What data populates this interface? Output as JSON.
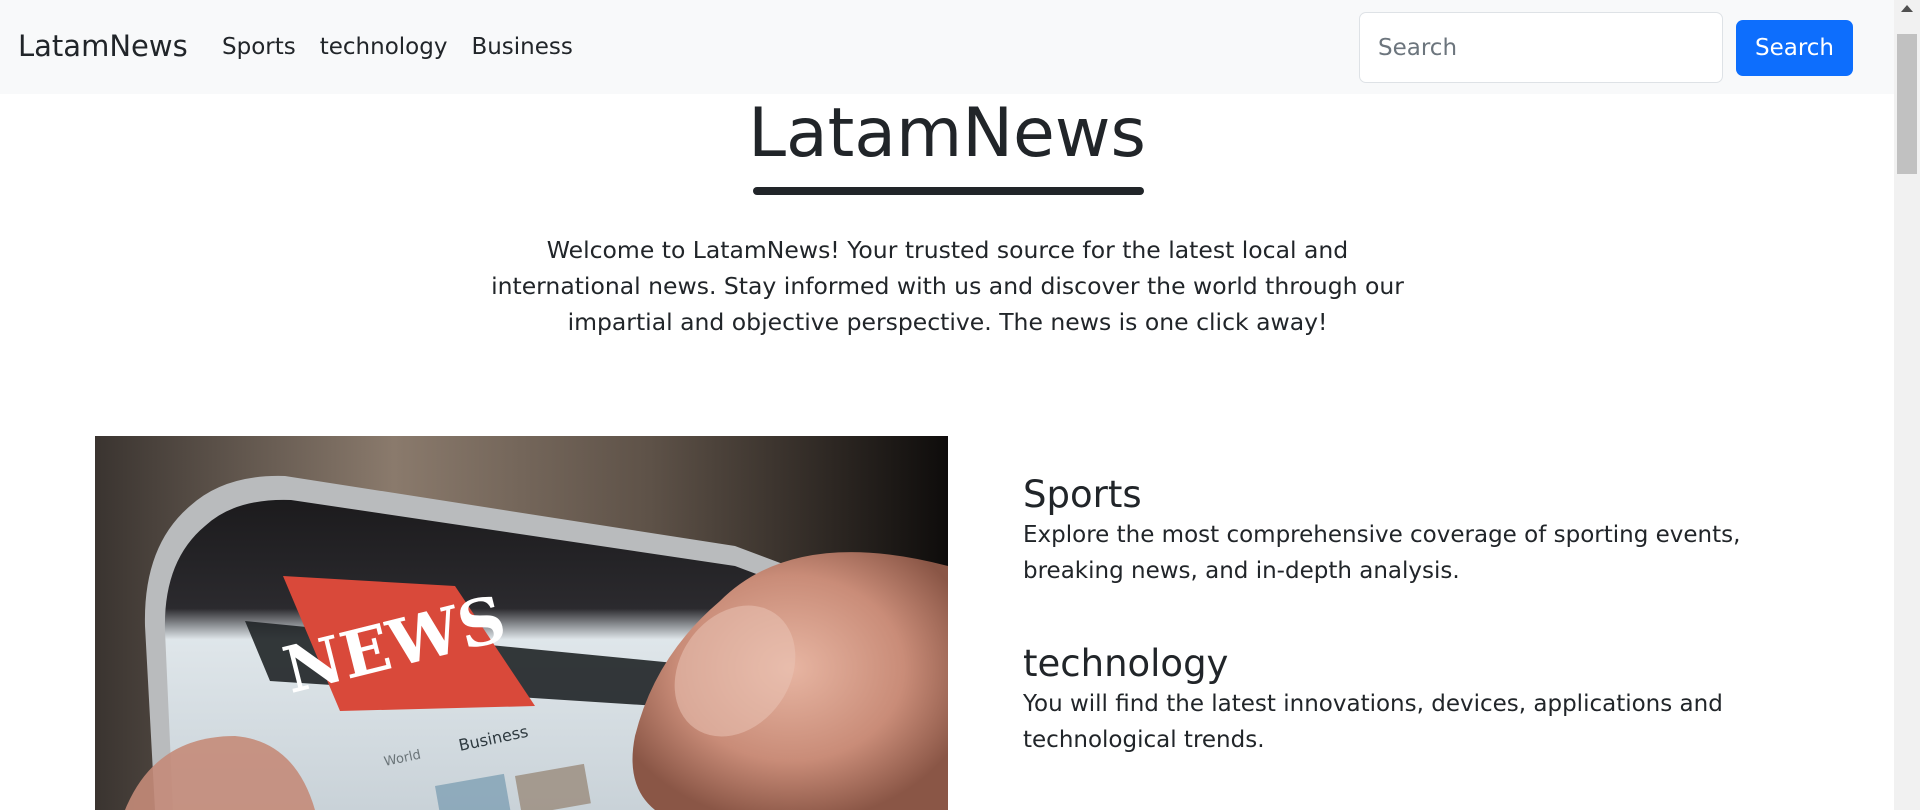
{
  "navbar": {
    "brand": "LatamNews",
    "links": [
      "Sports",
      "technology",
      "Business"
    ],
    "search_placeholder": "Search",
    "search_button": "Search"
  },
  "hero": {
    "title": "LatamNews",
    "welcome": "Welcome to LatamNews! Your trusted source for the latest local and international news. Stay informed with us and discover the world through our impartial and objective perspective. The news is one click away!"
  },
  "feature_image": {
    "label": "NEWS",
    "tabs": [
      "World",
      "Business"
    ]
  },
  "categories": [
    {
      "title": "Sports",
      "description": "Explore the most comprehensive coverage of sporting events, breaking news, and in-depth analysis."
    },
    {
      "title": "technology",
      "description": "You will find the latest innovations, devices, applications and technological trends."
    }
  ],
  "colors": {
    "primary": "#0d6efd",
    "navbar_bg": "#f8f9fa",
    "text": "#212529",
    "news_red": "#d9493a"
  }
}
